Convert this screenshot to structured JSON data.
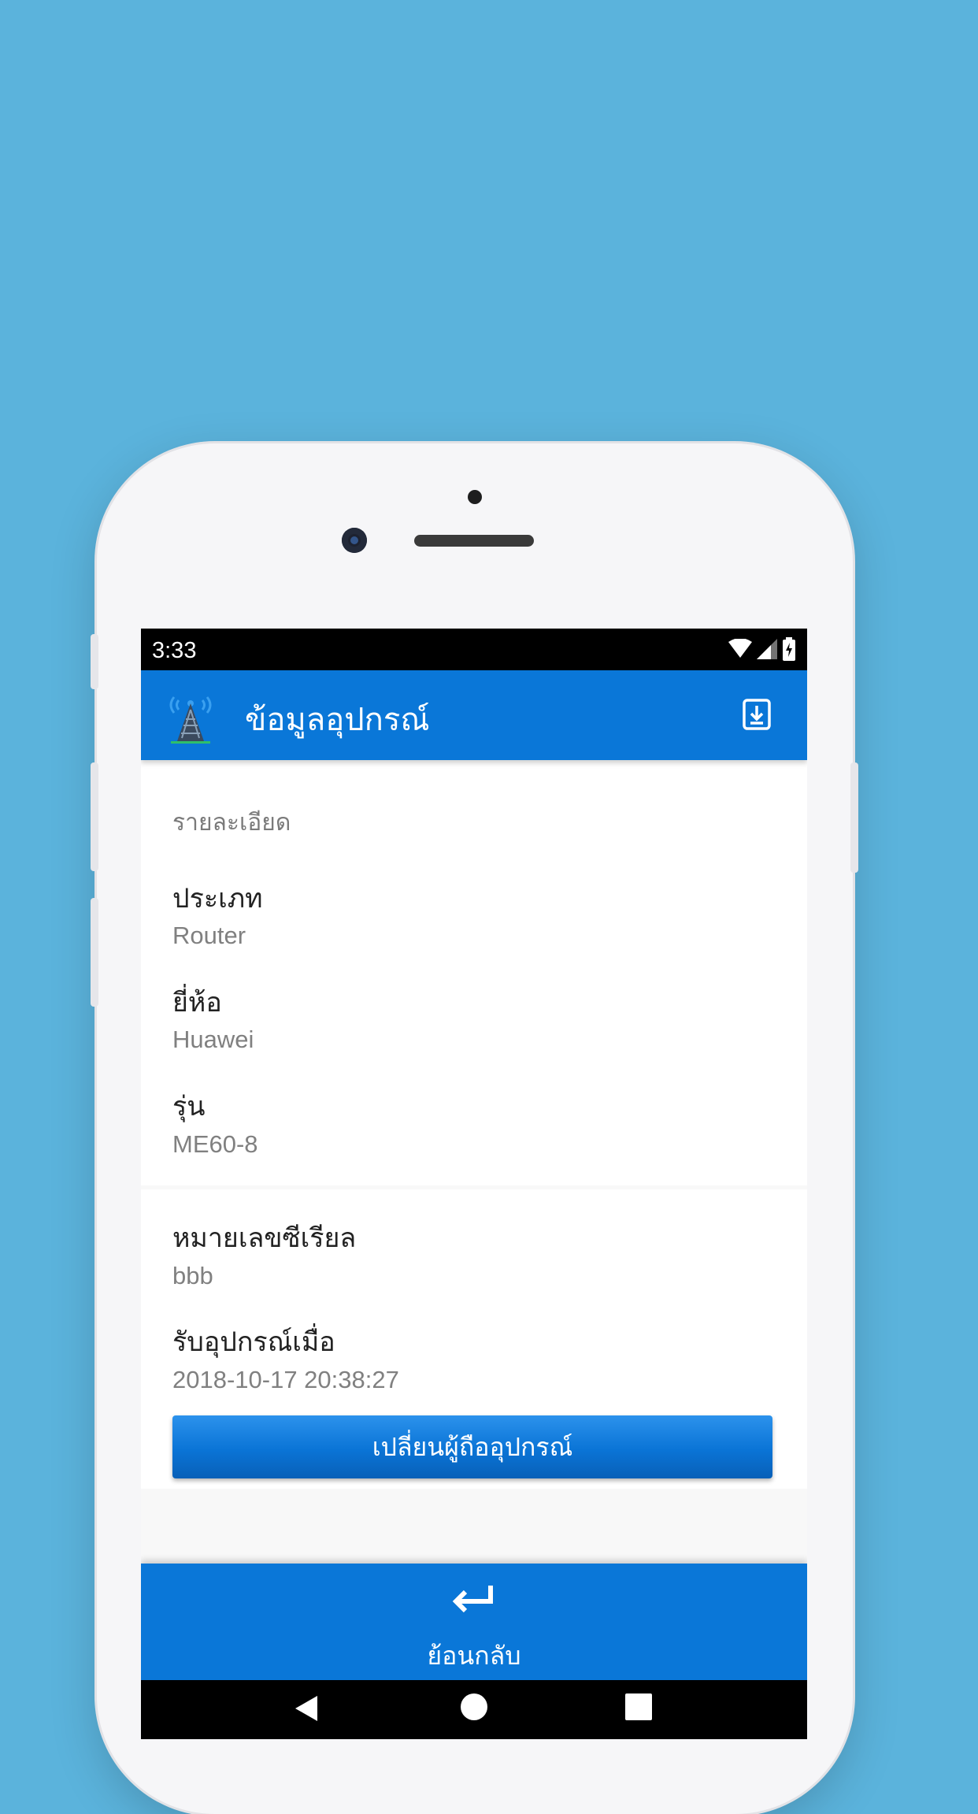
{
  "status_bar": {
    "time": "3:33",
    "icons": [
      "wifi-icon",
      "signal-icon",
      "battery-charging-icon"
    ]
  },
  "app_bar": {
    "logo_icon": "radio-tower-icon",
    "title": "ข้อมูลอุปกรณ์",
    "action_icon": "download-icon"
  },
  "details": {
    "section_title": "รายละเอียด",
    "fields": [
      {
        "label": "ประเภท",
        "value": "Router"
      },
      {
        "label": "ยี่ห้อ",
        "value": "Huawei"
      },
      {
        "label": "รุ่น",
        "value": "ME60-8"
      }
    ]
  },
  "holding": {
    "fields": [
      {
        "label": "หมายเลขซีเรียล",
        "value": "bbb"
      },
      {
        "label": "รับอุปกรณ์เมื่อ",
        "value": "2018-10-17 20:38:27"
      }
    ],
    "change_holder_button": "เปลี่ยนผู้ถืออุปกรณ์"
  },
  "bottom_bar": {
    "back_icon": "return-arrow-icon",
    "back_label": "ย้อนกลับ"
  },
  "nav_bar": {
    "icons": [
      "nav-back-icon",
      "nav-home-icon",
      "nav-recents-icon"
    ]
  },
  "colors": {
    "background": "#5bb3dc",
    "primary": "#0a77d8",
    "text_dark": "#222222",
    "text_muted": "#808080"
  }
}
